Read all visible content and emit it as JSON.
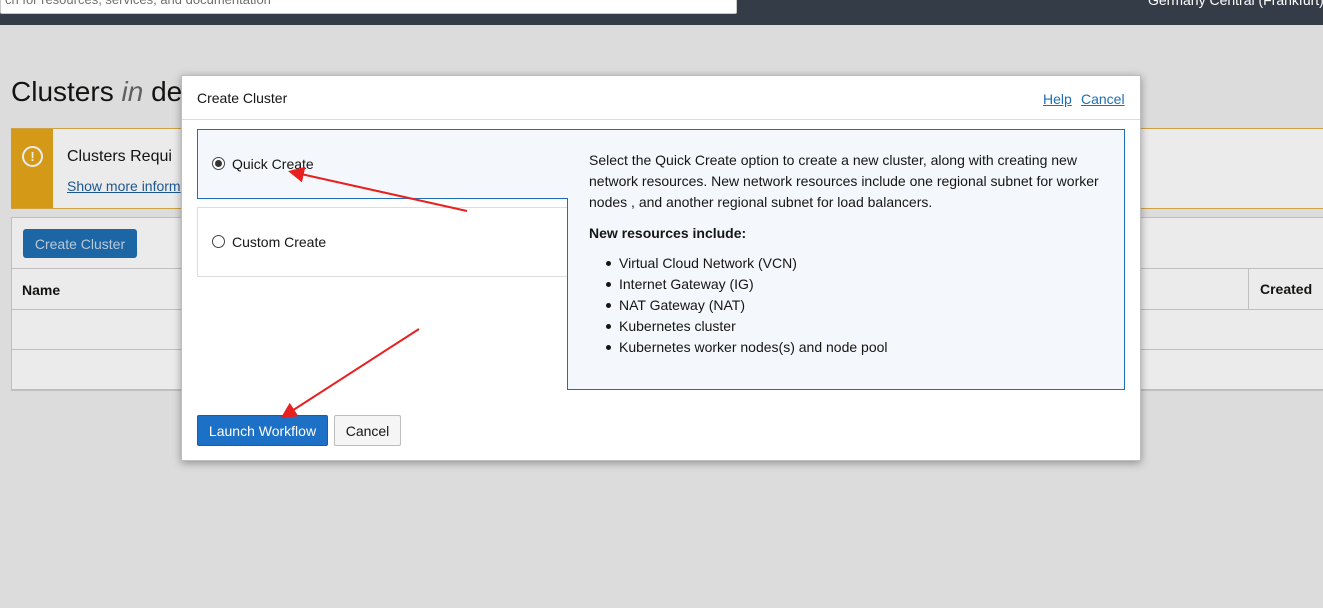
{
  "topbar": {
    "search_placeholder": "ch for resources, services, and documentation",
    "region": "Germany Central (Frankfurt)"
  },
  "page": {
    "title_prefix": "Clusters",
    "title_in": "in",
    "title_suffix": "de"
  },
  "notice": {
    "title": "Clusters Requi",
    "link": "Show more inform"
  },
  "list": {
    "create_button": "Create Cluster",
    "columns": [
      "Name",
      "Created"
    ]
  },
  "dialog": {
    "title": "Create Cluster",
    "help_link": "Help",
    "cancel_link": "Cancel",
    "options": [
      {
        "label": "Quick Create",
        "selected": true
      },
      {
        "label": "Custom Create",
        "selected": false
      }
    ],
    "description": "Select the Quick Create option to create a new cluster, along with creating new network resources. New network resources include one regional subnet for worker nodes , and another regional subnet for load balancers.",
    "resources_heading": "New resources include:",
    "resources": [
      "Virtual Cloud Network (VCN)",
      "Internet Gateway (IG)",
      "NAT Gateway (NAT)",
      "Kubernetes cluster",
      "Kubernetes worker nodes(s) and node pool"
    ],
    "launch_button": "Launch Workflow",
    "cancel_button": "Cancel"
  },
  "colors": {
    "primary": "#1c70c6",
    "warning": "#e8a71b",
    "annotation_arrow": "#e8201f"
  }
}
